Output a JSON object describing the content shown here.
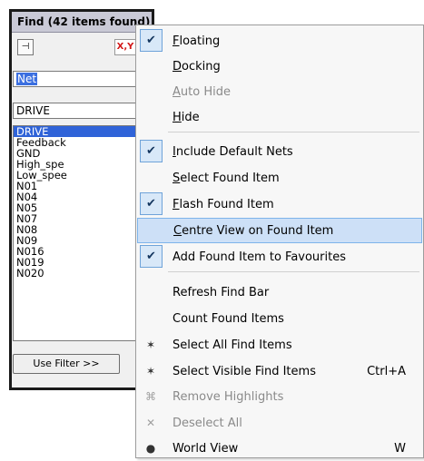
{
  "find_panel": {
    "title": "Find (42 items found)",
    "close_glyph": "×",
    "pin_glyph": "⊣",
    "xy_label": "X,Y",
    "net_field_value": "Net",
    "drive_field_value": "DRIVE",
    "items": [
      "DRIVE",
      "Feedback",
      "GND",
      "High_spe",
      "Low_spee",
      "N01",
      "N04",
      "N05",
      "N07",
      "N08",
      "N09",
      "N016",
      "N019",
      "N020"
    ],
    "selected_item": "DRIVE",
    "use_filter_label": "Use Filter >>"
  },
  "menu": {
    "items": [
      {
        "label": "Floating",
        "u": "F",
        "checked": true
      },
      {
        "label": "Docking",
        "u": "D"
      },
      {
        "label": "Auto Hide",
        "u": "A",
        "disabled": true
      },
      {
        "label": "Hide",
        "u": "H"
      },
      {
        "label": "Include Default Nets",
        "u": "I",
        "checked": true
      },
      {
        "label": "Select Found Item",
        "u": "S"
      },
      {
        "label": "Flash Found Item",
        "u": "F",
        "checked": true
      },
      {
        "label": "Centre View on Found Item",
        "u": "C",
        "highlighted": true
      },
      {
        "label": "Add Found Item to Favourites",
        "checked": true
      },
      {
        "label": "Refresh Find Bar"
      },
      {
        "label": "Count Found Items"
      },
      {
        "label": "Select All Find Items",
        "icon": "select-all-icon"
      },
      {
        "label": "Select Visible Find Items",
        "icon": "select-visible-icon",
        "shortcut": "Ctrl+A"
      },
      {
        "label": "Remove Highlights",
        "icon": "remove-highlights-icon",
        "disabled": true
      },
      {
        "label": "Deselect All",
        "icon": "deselect-all-icon",
        "disabled": true
      },
      {
        "label": "World View",
        "icon": "world-view-icon",
        "shortcut": "W"
      }
    ]
  },
  "colors": {
    "highlight_bg": "#cde0f7",
    "check_bg": "#d8e8f8",
    "selection_blue": "#2f63d8",
    "xy_red": "#d21818"
  }
}
